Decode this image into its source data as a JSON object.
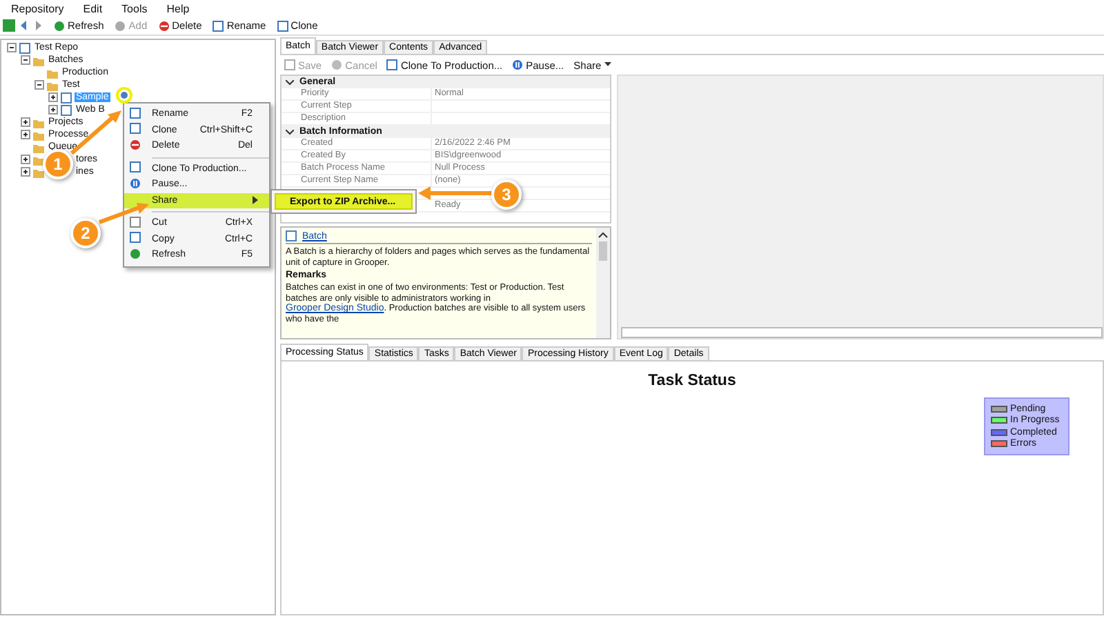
{
  "menu": [
    "Repository",
    "Edit",
    "Tools",
    "Help"
  ],
  "toolbar": [
    {
      "label": "Refresh",
      "disabled": false
    },
    {
      "label": "Add",
      "disabled": true
    },
    {
      "label": "Delete",
      "disabled": false
    },
    {
      "label": "Rename",
      "disabled": false
    },
    {
      "label": "Clone",
      "disabled": false
    }
  ],
  "tree": [
    {
      "label": "Test Repo",
      "expanded": true,
      "selected": false,
      "children": [
        {
          "label": "Batches",
          "expanded": true,
          "selected": false,
          "children": [
            {
              "label": "Production",
              "selected": false
            },
            {
              "label": "Test",
              "expanded": true,
              "selected": false,
              "children": [
                {
                  "label": "Sample",
                  "expanded": false,
                  "selected": true
                },
                {
                  "label": "Web B",
                  "expanded": false,
                  "selected": false
                }
              ]
            }
          ]
        },
        {
          "label": "Projects",
          "expanded": false,
          "selected": false
        },
        {
          "label": "Processe",
          "expanded": false,
          "selected": false
        },
        {
          "label": "Queue",
          "selected": false
        },
        {
          "label": "tores",
          "kind": "covered",
          "expanded": false,
          "selected": false
        },
        {
          "label": "ines",
          "kind": "covered",
          "expanded": false,
          "selected": false
        }
      ]
    }
  ],
  "context_menu": {
    "groups": [
      [
        {
          "label": "Rename",
          "shortcut": "F2",
          "submenu": false,
          "highlighted": false
        },
        {
          "label": "Clone",
          "shortcut": "Ctrl+Shift+C",
          "submenu": false,
          "highlighted": false
        },
        {
          "label": "Delete",
          "shortcut": "Del",
          "submenu": false,
          "highlighted": false
        }
      ],
      [
        {
          "label": "Clone To Production...",
          "submenu": false,
          "highlighted": false
        },
        {
          "label": "Pause...",
          "submenu": false,
          "highlighted": false
        },
        {
          "label": "Share",
          "submenu": true,
          "highlighted": true
        }
      ],
      [
        {
          "label": "Cut",
          "shortcut": "Ctrl+X",
          "submenu": false,
          "highlighted": false
        },
        {
          "label": "Copy",
          "shortcut": "Ctrl+C",
          "submenu": false,
          "highlighted": false
        },
        {
          "label": "Refresh",
          "shortcut": "F5",
          "submenu": false,
          "highlighted": false
        }
      ]
    ]
  },
  "submenu": {
    "items": [
      {
        "label": "Export to ZIP Archive...",
        "highlighted": true
      }
    ]
  },
  "callouts": [
    {
      "number": "1"
    },
    {
      "number": "2"
    },
    {
      "number": "3"
    }
  ],
  "detail_tabs": [
    {
      "label": "Batch",
      "selected": true
    },
    {
      "label": "Batch Viewer",
      "selected": false
    },
    {
      "label": "Contents",
      "selected": false
    },
    {
      "label": "Advanced",
      "selected": false
    }
  ],
  "detail_toolbar": [
    {
      "label": "Save",
      "disabled": true,
      "dropdown": false
    },
    {
      "label": "Cancel",
      "disabled": true,
      "dropdown": false
    },
    {
      "label": "Clone To Production...",
      "disabled": false,
      "dropdown": false
    },
    {
      "label": "Pause...",
      "disabled": false,
      "dropdown": false
    },
    {
      "label": "Share",
      "disabled": false,
      "dropdown": true
    }
  ],
  "properties": [
    {
      "title": "General",
      "rows": [
        {
          "label": "Priority",
          "value": "Normal"
        },
        {
          "label": "Current Step"
        },
        {
          "label": "Description"
        }
      ]
    },
    {
      "title": "Batch Information",
      "rows": [
        {
          "label": "Created",
          "value": "2/16/2022 2:46 PM"
        },
        {
          "label": "Created By",
          "value": "BIS\\dgreenwood"
        },
        {
          "label": "Batch Process Name",
          "value": "Null Process"
        },
        {
          "label": "Current Step Name",
          "value": "(none)"
        },
        {},
        {
          "value": "Ready"
        }
      ]
    }
  ],
  "help": {
    "title": "Batch",
    "summary": "A Batch is a hierarchy of folders and pages which serves as the fundamental unit of capture in Grooper.",
    "remarks_heading": "Remarks",
    "remarks_before": "Batches can exist in one of two environments: Test or Production.  Test batches are only visible to administrators working in",
    "remarks_link": "Grooper Design Studio",
    "remarks_after": ". Production batches are visible to all system users who have the"
  },
  "bottom_tabs": [
    {
      "label": "Processing Status",
      "selected": true
    },
    {
      "label": "Statistics",
      "selected": false
    },
    {
      "label": "Tasks",
      "selected": false
    },
    {
      "label": "Batch Viewer",
      "selected": false
    },
    {
      "label": "Processing History",
      "selected": false
    },
    {
      "label": "Event Log",
      "selected": false
    },
    {
      "label": "Details",
      "selected": false
    }
  ],
  "task_status": {
    "title": "Task Status",
    "legend": [
      {
        "label": "Pending",
        "color": "#a0a0a0"
      },
      {
        "label": "In Progress",
        "color": "#66ff66"
      },
      {
        "label": "Completed",
        "color": "#6666ff"
      },
      {
        "label": "Errors",
        "color": "#ff6666"
      }
    ]
  }
}
